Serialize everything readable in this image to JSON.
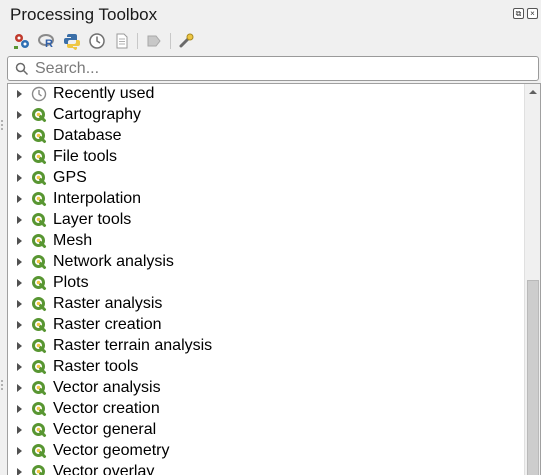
{
  "panel": {
    "title": "Processing Toolbox"
  },
  "toolbar": {
    "buttons": [
      {
        "name": "models-icon"
      },
      {
        "name": "r-scripts-icon"
      },
      {
        "name": "python-scripts-icon"
      },
      {
        "name": "history-icon"
      },
      {
        "name": "results-viewer-icon"
      },
      {
        "name": "in-place-edit-icon"
      },
      {
        "name": "options-icon"
      }
    ]
  },
  "search": {
    "placeholder": "Search..."
  },
  "tree": {
    "items": [
      {
        "label": "Recently used",
        "icon": "clock-icon"
      },
      {
        "label": "Cartography",
        "icon": "qgis-icon"
      },
      {
        "label": "Database",
        "icon": "qgis-icon"
      },
      {
        "label": "File tools",
        "icon": "qgis-icon"
      },
      {
        "label": "GPS",
        "icon": "qgis-icon"
      },
      {
        "label": "Interpolation",
        "icon": "qgis-icon"
      },
      {
        "label": "Layer tools",
        "icon": "qgis-icon"
      },
      {
        "label": "Mesh",
        "icon": "qgis-icon"
      },
      {
        "label": "Network analysis",
        "icon": "qgis-icon"
      },
      {
        "label": "Plots",
        "icon": "qgis-icon"
      },
      {
        "label": "Raster analysis",
        "icon": "qgis-icon"
      },
      {
        "label": "Raster creation",
        "icon": "qgis-icon"
      },
      {
        "label": "Raster terrain analysis",
        "icon": "qgis-icon"
      },
      {
        "label": "Raster tools",
        "icon": "qgis-icon"
      },
      {
        "label": "Vector analysis",
        "icon": "qgis-icon"
      },
      {
        "label": "Vector creation",
        "icon": "qgis-icon"
      },
      {
        "label": "Vector general",
        "icon": "qgis-icon"
      },
      {
        "label": "Vector geometry",
        "icon": "qgis-icon"
      },
      {
        "label": "Vector overlay",
        "icon": "qgis-icon"
      }
    ]
  },
  "colors": {
    "qgis_green": "#589632",
    "accent_yellow": "#eec643"
  }
}
